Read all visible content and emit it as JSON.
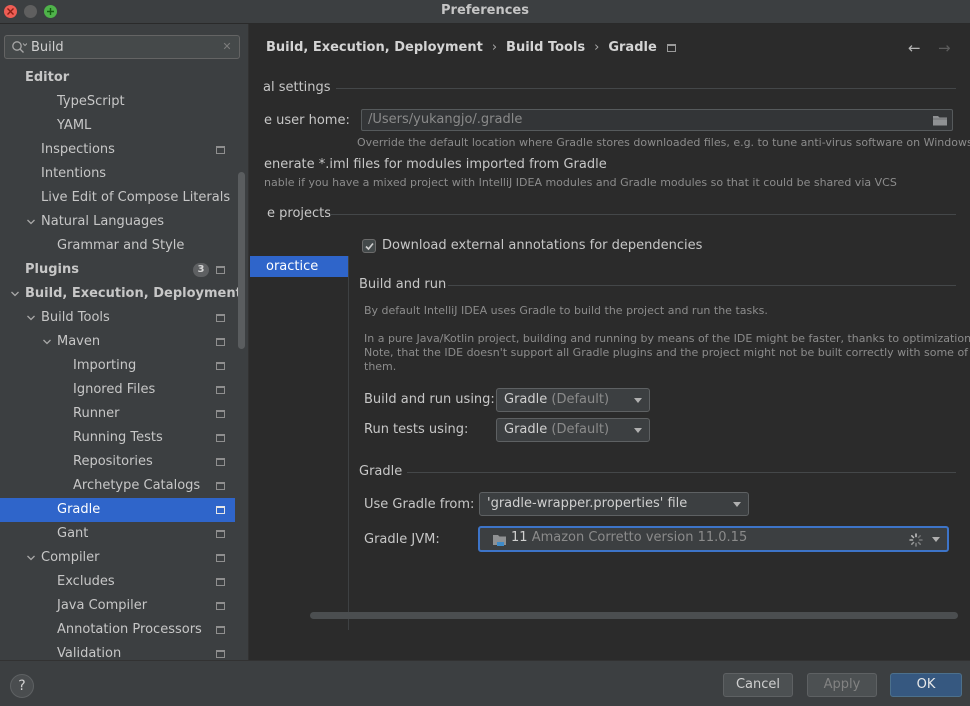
{
  "window": {
    "title": "Preferences"
  },
  "search": {
    "value": "Build"
  },
  "sidebar": {
    "items": [
      {
        "label": "Editor",
        "indent": 0,
        "bold": true
      },
      {
        "label": "TypeScript",
        "indent": 2
      },
      {
        "label": "YAML",
        "indent": 2
      },
      {
        "label": "Inspections",
        "indent": 1,
        "project": true
      },
      {
        "label": "Intentions",
        "indent": 1
      },
      {
        "label": "Live Edit of Compose Literals",
        "indent": 1
      },
      {
        "label": "Natural Languages",
        "indent": 1,
        "expanded": true
      },
      {
        "label": "Grammar and Style",
        "indent": 2
      },
      {
        "label": "Plugins",
        "indent": 0,
        "bold": true,
        "badge": "3",
        "project": true
      },
      {
        "label": "Build, Execution, Deployment",
        "indent": 0,
        "bold": true,
        "expanded": true
      },
      {
        "label": "Build Tools",
        "indent": 1,
        "expanded": true,
        "project": true
      },
      {
        "label": "Maven",
        "indent": 2,
        "expanded": true,
        "project": true
      },
      {
        "label": "Importing",
        "indent": 3,
        "project": true
      },
      {
        "label": "Ignored Files",
        "indent": 3,
        "project": true
      },
      {
        "label": "Runner",
        "indent": 3,
        "project": true
      },
      {
        "label": "Running Tests",
        "indent": 3,
        "project": true
      },
      {
        "label": "Repositories",
        "indent": 3,
        "project": true
      },
      {
        "label": "Archetype Catalogs",
        "indent": 3,
        "project": true
      },
      {
        "label": "Gradle",
        "indent": 2,
        "selected": true,
        "project": true
      },
      {
        "label": "Gant",
        "indent": 2,
        "project": true
      },
      {
        "label": "Compiler",
        "indent": 1,
        "expanded": true,
        "project": true
      },
      {
        "label": "Excludes",
        "indent": 2,
        "project": true
      },
      {
        "label": "Java Compiler",
        "indent": 2,
        "project": true
      },
      {
        "label": "Annotation Processors",
        "indent": 2,
        "project": true
      },
      {
        "label": "Validation",
        "indent": 2,
        "project": true
      }
    ]
  },
  "breadcrumb": {
    "items": [
      "Build, Execution, Deployment",
      "Build Tools",
      "Gradle"
    ],
    "separator": "›"
  },
  "general": {
    "section_title": "al settings",
    "user_home_label": "e user home:",
    "user_home_placeholder": "/Users/yukangjo/.gradle",
    "user_home_hint": "Override the default location where Gradle stores downloaded files, e.g. to tune anti-virus software on Windows",
    "iml_label": "enerate *.iml files for modules imported from Gradle",
    "iml_hint": "nable if you have a mixed project with IntelliJ IDEA modules and Gradle modules so that it could be shared via VCS"
  },
  "projects": {
    "section_title": "e projects",
    "selected": "oractice"
  },
  "download_annotations": {
    "label": "Download external annotations for dependencies",
    "checked": true
  },
  "build_and_run": {
    "title": "Build and run",
    "desc1": "By default IntelliJ IDEA uses Gradle to build the project and run the tasks.",
    "desc2": "In a pure Java/Kotlin project, building and running by means of the IDE might be faster, thanks to optimizations.",
    "desc3": "Note, that the IDE doesn't support all Gradle plugins and the project might not be built correctly with some of",
    "desc4": "them.",
    "build_using_label": "Build and run using:",
    "build_using_value": "Gradle",
    "build_using_suffix": "(Default)",
    "tests_using_label": "Run tests using:",
    "tests_using_value": "Gradle",
    "tests_using_suffix": "(Default)"
  },
  "gradle": {
    "title": "Gradle",
    "use_from_label": "Use Gradle from:",
    "use_from_value": "'gradle-wrapper.properties' file",
    "jvm_label": "Gradle JVM:",
    "jvm_version": "11",
    "jvm_name": "Amazon Corretto version 11.0.15"
  },
  "footer": {
    "help": "?",
    "cancel": "Cancel",
    "apply": "Apply",
    "ok": "OK"
  },
  "colors": {
    "accent": "#2f65ca",
    "primary_button": "#365880",
    "background": "#2b2b2b",
    "sidebar": "#3c3f41"
  }
}
